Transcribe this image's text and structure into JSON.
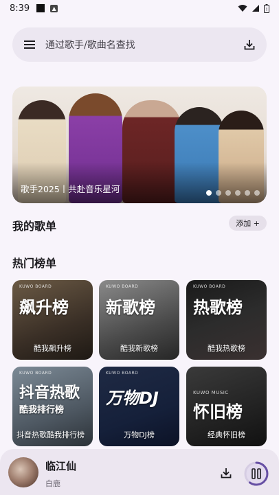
{
  "status": {
    "time": "8:39"
  },
  "search": {
    "placeholder": "通过歌手/歌曲名查找"
  },
  "banner": {
    "caption": "歌手2025丨共赴音乐星河",
    "slide_count": 6,
    "active_slide": 1
  },
  "my_songs": {
    "title": "我的歌单",
    "add_label": "添加 +"
  },
  "hot_charts": {
    "title": "热门榜单",
    "items": [
      {
        "brand": "KUWO BOARD",
        "big": "飙升榜",
        "label": "酷我飙升榜"
      },
      {
        "brand": "KUWO BOARD",
        "big": "新歌榜",
        "label": "酷我新歌榜"
      },
      {
        "brand": "KUWO BOARD",
        "big": "热歌榜",
        "label": "酷我热歌榜"
      },
      {
        "brand": "KUWO BOARD",
        "big": "抖音热歌",
        "sub": "酷我排行榜",
        "label": "抖音热歌酷我排行榜"
      },
      {
        "brand": "KUWO BOARD",
        "big": "万物DJ",
        "label": "万物DJ榜"
      },
      {
        "brand": "KUWO MUSIC",
        "big": "怀旧榜",
        "label": "经典怀旧榜"
      }
    ]
  },
  "player": {
    "title": "临江仙",
    "artist": "白鹿",
    "progress": 0.6
  },
  "colors": {
    "accent": "#6750a4",
    "background": "#f8f4fb"
  }
}
